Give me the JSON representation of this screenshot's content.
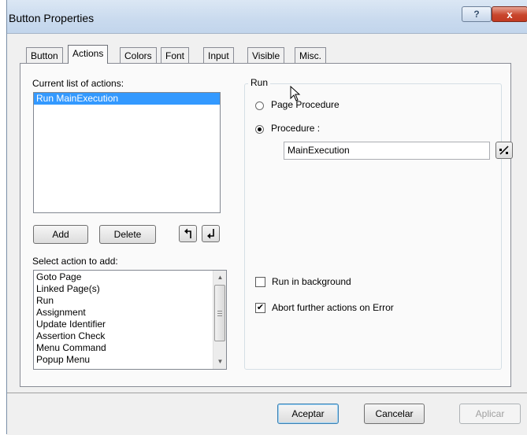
{
  "window": {
    "title": "Button Properties"
  },
  "title_buttons": {
    "help": "?",
    "close": "x"
  },
  "tabs": [
    {
      "label": "Button"
    },
    {
      "label": "Actions"
    },
    {
      "label": "Colors"
    },
    {
      "label": "Font"
    },
    {
      "label": "Input"
    },
    {
      "label": "Visible"
    },
    {
      "label": "Misc."
    }
  ],
  "actions_tab": {
    "current_list_label": "Current list of actions:",
    "current_list_items": [
      "Run MainExecution"
    ],
    "add_button": "Add",
    "delete_button": "Delete",
    "select_label": "Select action to add:",
    "available_actions": [
      "Goto Page",
      "Linked Page(s)",
      "Run",
      "Assignment",
      "Update Identifier",
      "Assertion Check",
      "Menu Command",
      "Popup Menu"
    ],
    "run_group": {
      "title": "Run",
      "option_page_procedure": "Page Procedure",
      "option_procedure": "Procedure :",
      "selected_option": "Procedure :",
      "procedure_value": "MainExecution",
      "run_in_background_label": "Run in background",
      "run_in_background_checked": false,
      "abort_on_error_label": "Abort further actions on Error",
      "abort_on_error_checked": true
    }
  },
  "footer": {
    "ok_button": "Aceptar",
    "cancel_button": "Cancelar",
    "apply_button": "Aplicar"
  },
  "colors": {
    "selection": "#3399ff",
    "close_button": "#c8462d"
  }
}
